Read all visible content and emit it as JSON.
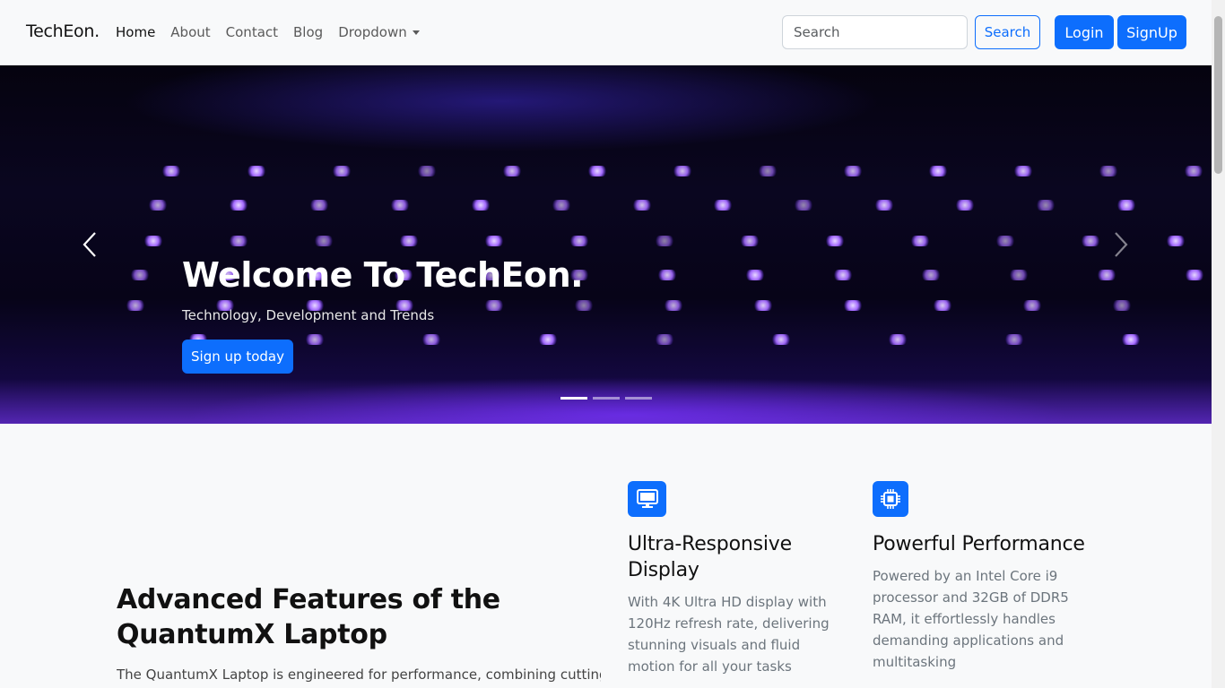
{
  "nav": {
    "brand": "TechEon.",
    "links": [
      {
        "label": "Home"
      },
      {
        "label": "About"
      },
      {
        "label": "Contact"
      },
      {
        "label": "Blog"
      },
      {
        "label": "Dropdown"
      }
    ],
    "search_placeholder": "Search",
    "search_button": "Search",
    "login_button": "Login",
    "signup_button": "SignUp"
  },
  "hero": {
    "title": "Welcome To TechEon.",
    "subtitle": "Technology, Development and Trends",
    "cta": "Sign up today",
    "slide_count": 3,
    "active_slide": 1
  },
  "features": {
    "heading": "Advanced Features of the QuantumX Laptop",
    "intro": "The QuantumX Laptop is engineered for performance, combining cutting-",
    "items": [
      {
        "title": "Ultra-Responsive Display",
        "description": "With 4K Ultra HD display with 120Hz refresh rate, delivering stunning visuals and fluid motion for all your tasks",
        "icon": "monitor-icon"
      },
      {
        "title": "Powerful Performance",
        "description": "Powered by an Intel Core i9 processor and 32GB of DDR5 RAM, it effortlessly handles demanding applications and multitasking",
        "icon": "cpu-icon"
      }
    ]
  },
  "colors": {
    "primary": "#0d6efd",
    "navbar_bg": "#f8f9fa"
  }
}
